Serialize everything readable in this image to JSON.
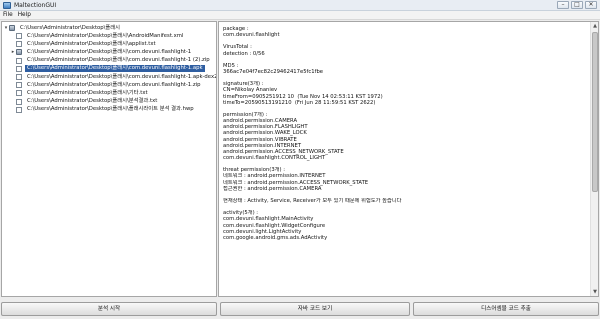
{
  "window": {
    "title": "MaltectionGUI",
    "controls": {
      "minimize": "–",
      "maximize": "□",
      "close": "✕"
    }
  },
  "menu": {
    "items": [
      "File",
      "Help"
    ]
  },
  "tree": {
    "root": "C:\\Users\\Administrator\\Desktop\\플래시",
    "items": [
      {
        "label": "C:\\Users\\Administrator\\Desktop\\플래시\\AndroidManifest.xml",
        "type": "file",
        "expandable": false,
        "selected": false
      },
      {
        "label": "C:\\Users\\Administrator\\Desktop\\플래시\\applist.txt",
        "type": "file",
        "expandable": false,
        "selected": false
      },
      {
        "label": "C:\\Users\\Administrator\\Desktop\\플래시\\com.devuni.flashlight-1",
        "type": "folder",
        "expandable": true,
        "selected": false
      },
      {
        "label": "C:\\Users\\Administrator\\Desktop\\플래시\\com.devuni.flashlight-1 (2).zip",
        "type": "file",
        "expandable": false,
        "selected": false
      },
      {
        "label": "C:\\Users\\Administrator\\Desktop\\플래시\\com.devuni.flashlight-1.apk",
        "type": "file",
        "expandable": false,
        "selected": true
      },
      {
        "label": "C:\\Users\\Administrator\\Desktop\\플래시\\com.devuni.flashlight-1.apk-dex2jar.jar",
        "type": "file",
        "expandable": false,
        "selected": false
      },
      {
        "label": "C:\\Users\\Administrator\\Desktop\\플래시\\com.devuni.flashlight-1.zip",
        "type": "file",
        "expandable": false,
        "selected": false
      },
      {
        "label": "C:\\Users\\Administrator\\Desktop\\플래시\\기타.txt",
        "type": "file",
        "expandable": false,
        "selected": false
      },
      {
        "label": "C:\\Users\\Administrator\\Desktop\\플래시\\분석결과.txt",
        "type": "file",
        "expandable": false,
        "selected": false
      },
      {
        "label": "C:\\Users\\Administrator\\Desktop\\플래시\\플래시라이트 분석 결과.hwp",
        "type": "file",
        "expandable": false,
        "selected": false
      }
    ]
  },
  "detail": {
    "lines": [
      "package :",
      "com.devuni.flashlight",
      "",
      "VirusTotal :",
      "detection : 0/56",
      "",
      "MD5 :",
      "366ac7e04f7ec82c29462417e5fc1fbe",
      "",
      "signature(3개) :",
      "CN=Nikolay Ananiev",
      "timeFrom=0905251912 10  (Tue Nov 14 02:53:11 KST 1972)",
      "timeTo=20590513191210  (Fri Jun 28 11:59:51 KST 2622)",
      "",
      "permission(7개) :",
      "android.permission.CAMERA",
      "android.permission.FLASHLIGHT",
      "android.permission.WAKE_LOCK",
      "android.permission.VIBRATE",
      "android.permission.INTERNET",
      "android.permission.ACCESS_NETWORK_STATE",
      "com.devuni.flashlight.CONTROL_LIGHT",
      "",
      "threat permission(3개) :",
      "네트워크 : android.permission.INTERNET",
      "네트워크 : android.permission.ACCESS_NETWORK_STATE",
      "접근권한 : android.permission.CAMERA",
      "",
      "현재상태 : Activity, Service, Receiver가 모두 있기 때문에 위험도가 높습니다",
      "",
      "activity(5개) :",
      "com.devuni.flashlight.MainActivity",
      "com.devuni.flashlight.WidgetConfigure",
      "com.devuni.light.LightActivity",
      "com.google.android.gms.ads.AdActivity"
    ]
  },
  "buttons": {
    "start": "분석 시작",
    "java": "자바 코드 보기",
    "disassemble": "디스어셈블 코드 추출"
  },
  "colors": {
    "selection": "#2f5ea1",
    "background": "#ececec"
  }
}
